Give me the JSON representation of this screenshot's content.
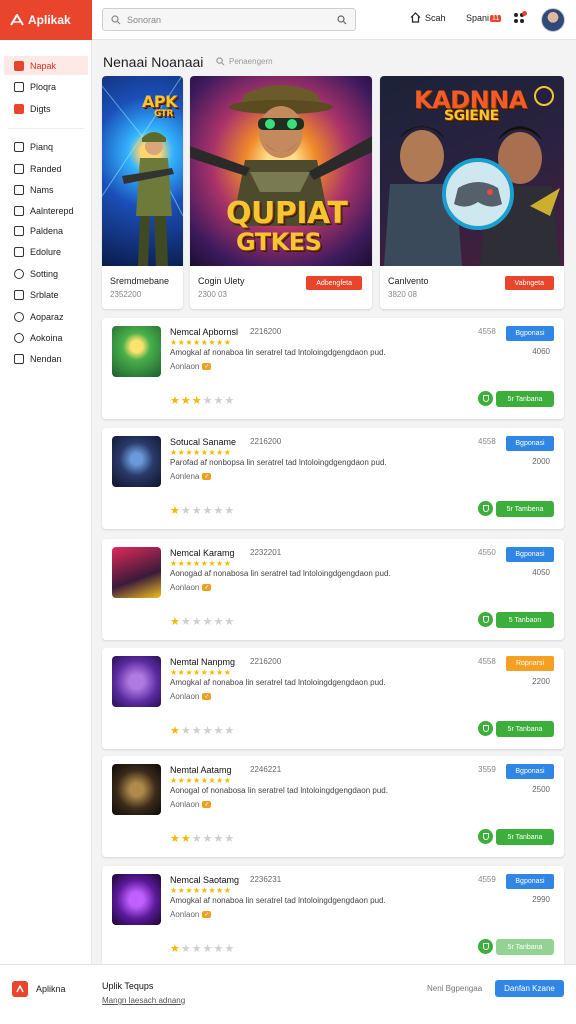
{
  "app": {
    "brand": "Aplikak"
  },
  "search": {
    "placeholder": "Sonoran"
  },
  "header": {
    "home_label": "Scah",
    "spam_label": "Spani",
    "spam_badge": "11"
  },
  "sidebar": {
    "items": [
      {
        "label": "Napak",
        "active": true,
        "icon": "home-icon"
      },
      {
        "label": "Ploqra",
        "icon": "grid-icon"
      },
      {
        "label": "Digts",
        "icon": "bookmark-icon"
      },
      {
        "label": "Pianq",
        "icon": "check-icon"
      },
      {
        "label": "Randed",
        "icon": "download-icon"
      },
      {
        "label": "Nams",
        "icon": "bell-icon"
      },
      {
        "label": "Aalnterepd",
        "icon": "list-icon"
      },
      {
        "label": "Paldena",
        "icon": "folder-icon"
      },
      {
        "label": "Edolure",
        "icon": "folder-icon"
      },
      {
        "label": "Sotting",
        "icon": "gear-icon"
      },
      {
        "label": "Srblate",
        "icon": "list-icon"
      },
      {
        "label": "Aoparaz",
        "icon": "refresh-icon"
      },
      {
        "label": "Aokoina",
        "icon": "circle-icon"
      },
      {
        "label": "Nendan",
        "icon": "menu-icon"
      }
    ]
  },
  "main": {
    "title": "Nenaai Noanaai",
    "subtitle": "Penaengern",
    "featured": [
      {
        "art_title": "APK",
        "art_sub": "GTR",
        "name": "Sremdmebane",
        "meta": "2352200",
        "button": ""
      },
      {
        "art_title": "QUPIAT",
        "art_sub": "GTKES",
        "name": "Cogin Ulety",
        "meta": "2300 03",
        "button": "Adbengfeta"
      },
      {
        "art_title": "KADNNA",
        "art_sub": "SGIENE",
        "name": "Canlvento",
        "meta": "3820 08",
        "button": "Vabngeta"
      }
    ],
    "apps": [
      {
        "name": "Nemcal Apbornsl",
        "version": "2216200",
        "stars": "★★★★★★★★",
        "desc": "Amogkal af nonaboa lin seratrel tad lntoloingdgengdaon pud.",
        "dev": "Aonlaon",
        "rating": 2,
        "half": true,
        "downloads": "4558",
        "category": "Bgponasi",
        "size": "4060",
        "install": "5r Tanbana",
        "cat_color": "blue"
      },
      {
        "name": "Sotucal Saname",
        "version": "2216200",
        "stars": "★★★★★★★★",
        "desc": "Parofad af nonbopsa lin seratrel tad lntoloingdgengdaon pud.",
        "dev": "Aonlena",
        "rating": 1,
        "half": false,
        "downloads": "4558",
        "category": "Bgponasi",
        "size": "2000",
        "install": "5r Tambena",
        "cat_color": "blue"
      },
      {
        "name": "Nemcal Karamg",
        "version": "2232201",
        "stars": "★★★★★★★★",
        "desc": "Aonogad af nonabosa lin seratrel tad lntoloingdgengdaon pud.",
        "dev": "Aonlaon",
        "rating": 1,
        "half": false,
        "downloads": "4550",
        "category": "Bgponasi",
        "size": "4050",
        "install": "5 Tanbaon",
        "cat_color": "blue"
      },
      {
        "name": "Nemtal Nanpmg",
        "version": "2216200",
        "stars": "★★★★★★★★",
        "desc": "Amogkal af nonaboa lin seratrel tad lntoloingdgengdaon pud.",
        "dev": "Aonlaon",
        "rating": 1,
        "half": false,
        "downloads": "4558",
        "category": "Ropnarsi",
        "size": "2200",
        "install": "5r Tanbana",
        "cat_color": "orange"
      },
      {
        "name": "Nemtal Aatamg",
        "version": "2246221",
        "stars": "★★★★★★★★",
        "desc": "Aonogal of nonabosa lin seratrel tad lntoloingdgengdaon pud.",
        "dev": "Aonlaon",
        "rating": 2,
        "half": false,
        "downloads": "3559",
        "category": "Bgponasi",
        "size": "2500",
        "install": "5r Tanbana",
        "cat_color": "blue"
      },
      {
        "name": "Nemcal Saotamg",
        "version": "2236231",
        "stars": "★★★★★★★★",
        "desc": "Amogkal af nonaboa lin seratrel tad lntoloingdgengdaon pud.",
        "dev": "Aonlaon",
        "rating": 1,
        "half": false,
        "downloads": "4559",
        "category": "Bgponasi",
        "size": "2990",
        "install": "5r Tanbana",
        "cat_color": "blue"
      }
    ]
  },
  "bottom": {
    "brand": "Aplikna",
    "title": "Uplik Tequps",
    "link": "Mangn laesach adnang",
    "secondary": "Neni Bgpengaa",
    "primary": "Danfan Kzane"
  },
  "colors": {
    "accent": "#e8452c",
    "blue": "#2f86e4",
    "green": "#3cae3c",
    "orange": "#f5a020"
  }
}
